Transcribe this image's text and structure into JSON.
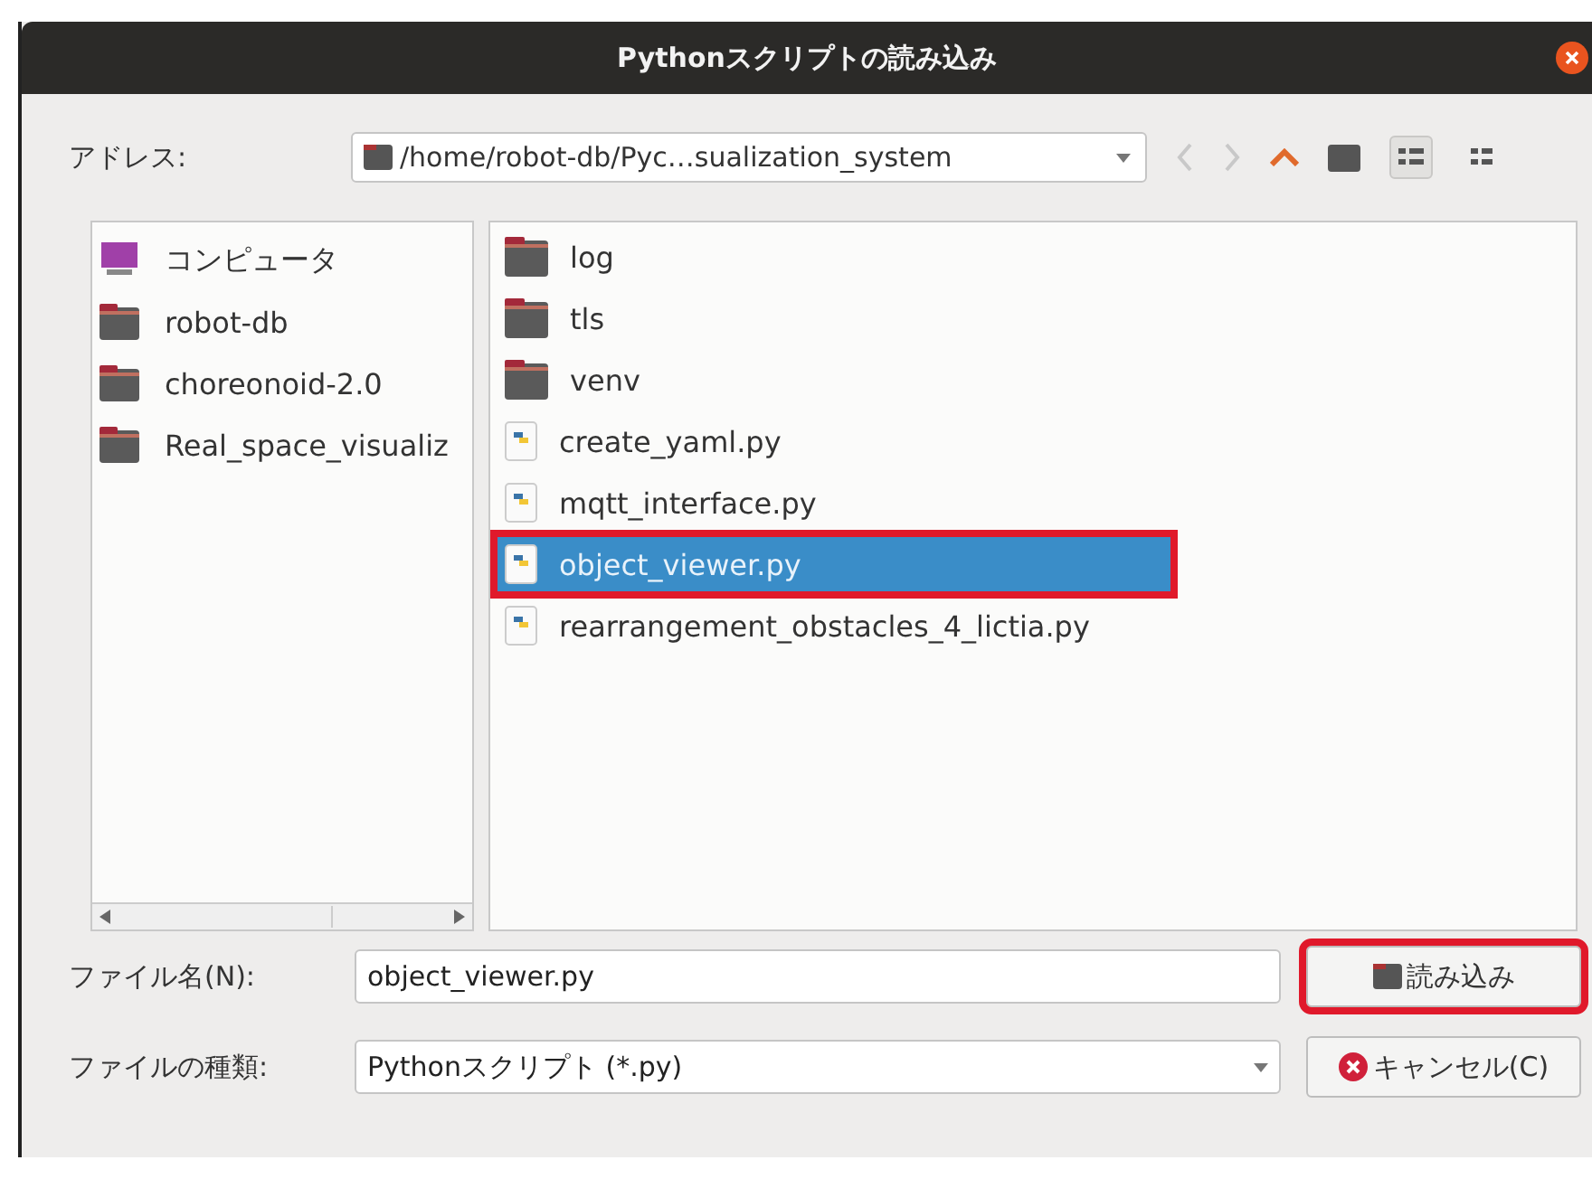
{
  "window": {
    "title": "Pythonスクリプトの読み込み"
  },
  "address": {
    "label": "アドレス:",
    "path": "/home/robot-db/Pyc…sualization_system"
  },
  "toolbar": [
    {
      "kind": "back",
      "disabled": true
    },
    {
      "kind": "forward",
      "disabled": true
    },
    {
      "kind": "up",
      "disabled": false
    },
    {
      "kind": "new-folder",
      "disabled": false
    },
    {
      "kind": "list-view",
      "selected": true
    },
    {
      "kind": "detail-view",
      "selected": false
    }
  ],
  "sidebar": {
    "items": [
      {
        "kind": "computer",
        "label": "コンピュータ"
      },
      {
        "kind": "folder",
        "label": "robot-db"
      },
      {
        "kind": "folder",
        "label": "choreonoid-2.0"
      },
      {
        "kind": "folder",
        "label": "Real_space_visualiz"
      }
    ]
  },
  "files": [
    {
      "kind": "folder",
      "name": "log",
      "selected": false,
      "highlighted": false
    },
    {
      "kind": "folder",
      "name": "tls",
      "selected": false,
      "highlighted": false
    },
    {
      "kind": "folder",
      "name": "venv",
      "selected": false,
      "highlighted": false
    },
    {
      "kind": "python",
      "name": "create_yaml.py",
      "selected": false,
      "highlighted": false
    },
    {
      "kind": "python",
      "name": "mqtt_interface.py",
      "selected": false,
      "highlighted": false
    },
    {
      "kind": "python",
      "name": "object_viewer.py",
      "selected": true,
      "highlighted": true
    },
    {
      "kind": "python",
      "name": "rearrangement_obstacles_4_lictia.py",
      "selected": false,
      "highlighted": false
    }
  ],
  "filename": {
    "label": "ファイル名(N):",
    "value": "object_viewer.py"
  },
  "filetype": {
    "label": "ファイルの種類:",
    "value": "Pythonスクリプト (*.py)"
  },
  "buttons": [
    {
      "kind": "open",
      "label": "読み込み",
      "highlighted": true
    },
    {
      "kind": "cancel",
      "label": "キャンセル(C)",
      "highlighted": false
    }
  ]
}
